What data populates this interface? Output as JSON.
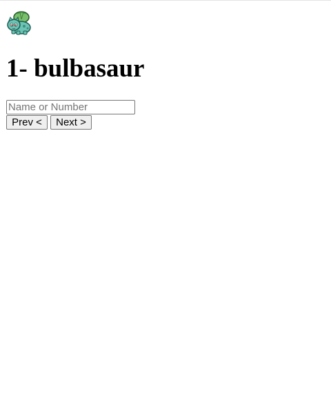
{
  "pokemon": {
    "title": "1- bulbasaur",
    "sprite_icon": "bulbasaur-sprite-icon"
  },
  "search": {
    "value": "",
    "placeholder": "Name or Number"
  },
  "nav": {
    "prev_label": "Prev <",
    "next_label": "Next >"
  },
  "colors": {
    "sprite_body": "#6cc4b4",
    "sprite_bulb": "#7ac06c",
    "sprite_outline": "#1a5a52",
    "sprite_eye": "#c0303a"
  }
}
